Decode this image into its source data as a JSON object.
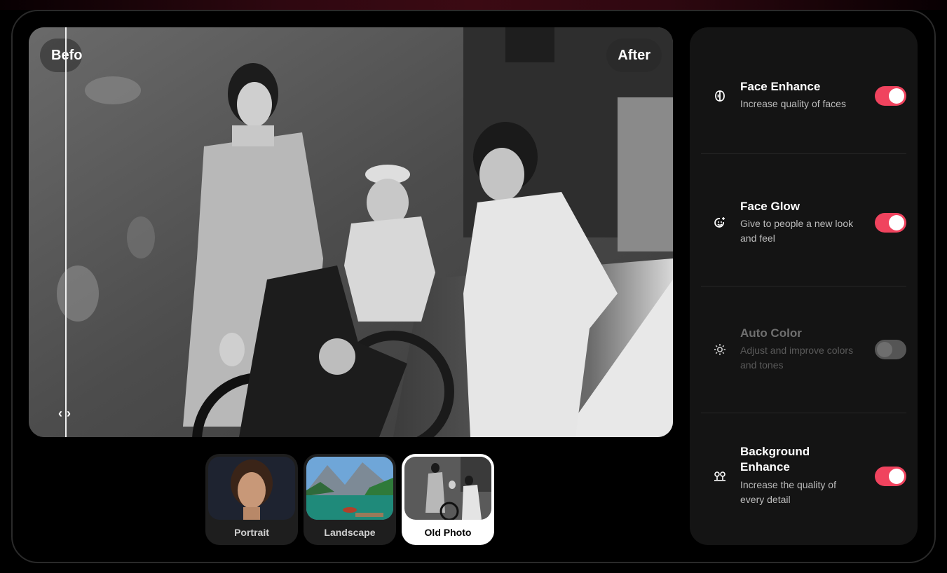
{
  "viewer": {
    "before_label": "Before",
    "after_label": "After",
    "handle_glyph": "‹›"
  },
  "samples": [
    {
      "label": "Portrait",
      "active": false
    },
    {
      "label": "Landscape",
      "active": false
    },
    {
      "label": "Old Photo",
      "active": true
    }
  ],
  "options": [
    {
      "title": "Face Enhance",
      "description": "Increase quality of faces",
      "icon": "face-enhance-icon",
      "enabled": true
    },
    {
      "title": "Face Glow",
      "description": "Give to people a new look and feel",
      "icon": "face-glow-icon",
      "enabled": true
    },
    {
      "title": "Auto Color",
      "description": "Adjust and improve colors and tones",
      "icon": "sun-icon",
      "enabled": false
    },
    {
      "title": "Background Enhance",
      "description": "Increase the quality of every detail",
      "icon": "trees-icon",
      "enabled": true
    }
  ],
  "colors": {
    "accent": "#f0435e",
    "panel": "#141414",
    "toggle_off": "#555555"
  }
}
